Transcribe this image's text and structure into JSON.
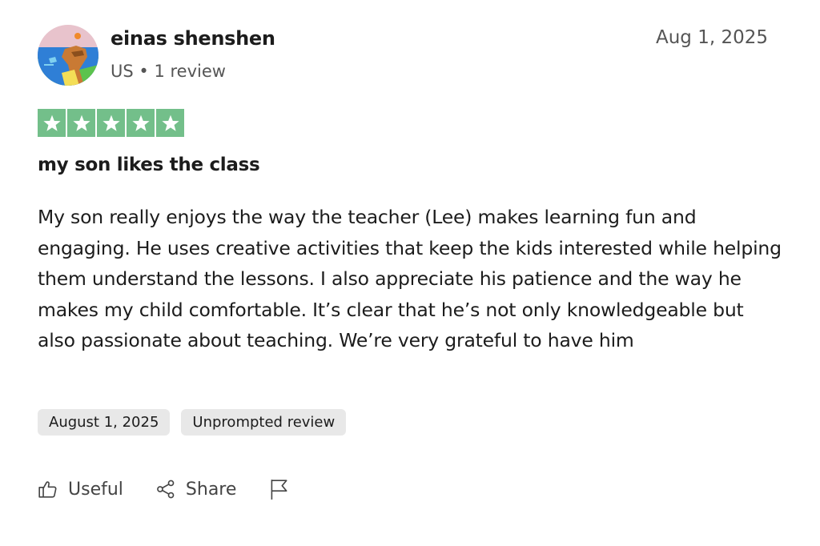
{
  "reviewer": {
    "name": "einas shenshen",
    "country": "US",
    "separator": "•",
    "review_count": "1 review"
  },
  "review": {
    "date": "Aug 1, 2025",
    "rating": 5,
    "rating_color": "#73bf8a",
    "title": "my son likes the class",
    "body": "My son really enjoys the way the teacher (Lee) makes learning fun and engaging. He uses creative activities that keep the kids interested while helping them understand the lessons. I also appreciate his patience and the way he makes my child comfortable. It’s clear that he’s not only knowledgeable but also passionate about teaching. We’re very grateful to have him",
    "tags": [
      "August 1, 2025",
      "Unprompted review"
    ]
  },
  "actions": {
    "useful_label": "Useful",
    "useful_icon": "thumbs-up-icon",
    "share_label": "Share",
    "share_icon": "share-icon",
    "report_icon": "flag-icon"
  }
}
